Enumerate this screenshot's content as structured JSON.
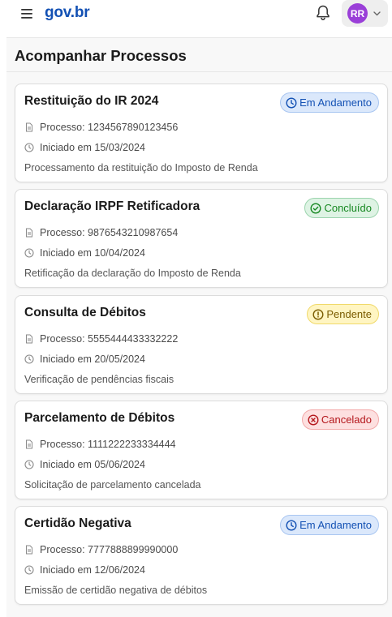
{
  "header": {
    "logo": "gov.br",
    "user_initials": "RR"
  },
  "page": {
    "title": "Acompanhar Processos"
  },
  "labels": {
    "process_prefix": "Processo: ",
    "started_prefix": "Iniciado em "
  },
  "status_colors": {
    "em_andamento": {
      "bg": "#dbe8fb",
      "border": "#a9c6f1",
      "text": "#1351b4"
    },
    "concluido": {
      "bg": "#def3e4",
      "border": "#9bd4ad",
      "text": "#168821"
    },
    "pendente": {
      "bg": "#fff5c2",
      "border": "#f0d96a",
      "text": "#7a5c00"
    },
    "cancelado": {
      "bg": "#fde0e0",
      "border": "#f2a9a9",
      "text": "#b4161b"
    }
  },
  "processes": [
    {
      "title": "Restituição do IR 2024",
      "status": "Em Andamento",
      "status_key": "em_andamento",
      "status_icon": "clock-icon",
      "number": "Processo: 1234567890123456",
      "started": "Iniciado em 15/03/2024",
      "description": "Processamento da restituição do Imposto de Renda"
    },
    {
      "title": "Declaração IRPF Retificadora",
      "status": "Concluído",
      "status_key": "concluido",
      "status_icon": "check-circle-icon",
      "number": "Processo: 9876543210987654",
      "started": "Iniciado em 10/04/2024",
      "description": "Retificação da declaração do Imposto de Renda"
    },
    {
      "title": "Consulta de Débitos",
      "status": "Pendente",
      "status_key": "pendente",
      "status_icon": "alert-circle-icon",
      "number": "Processo: 5555444433332222",
      "started": "Iniciado em 20/05/2024",
      "description": "Verificação de pendências fiscais"
    },
    {
      "title": "Parcelamento de Débitos",
      "status": "Cancelado",
      "status_key": "cancelado",
      "status_icon": "x-circle-icon",
      "number": "Processo: 1111222233334444",
      "started": "Iniciado em 05/06/2024",
      "description": "Solicitação de parcelamento cancelada"
    },
    {
      "title": "Certidão Negativa",
      "status": "Em Andamento",
      "status_key": "em_andamento",
      "status_icon": "clock-icon",
      "number": "Processo: 7777888899990000",
      "started": "Iniciado em 12/06/2024",
      "description": "Emissão de certidão negativa de débitos"
    }
  ]
}
